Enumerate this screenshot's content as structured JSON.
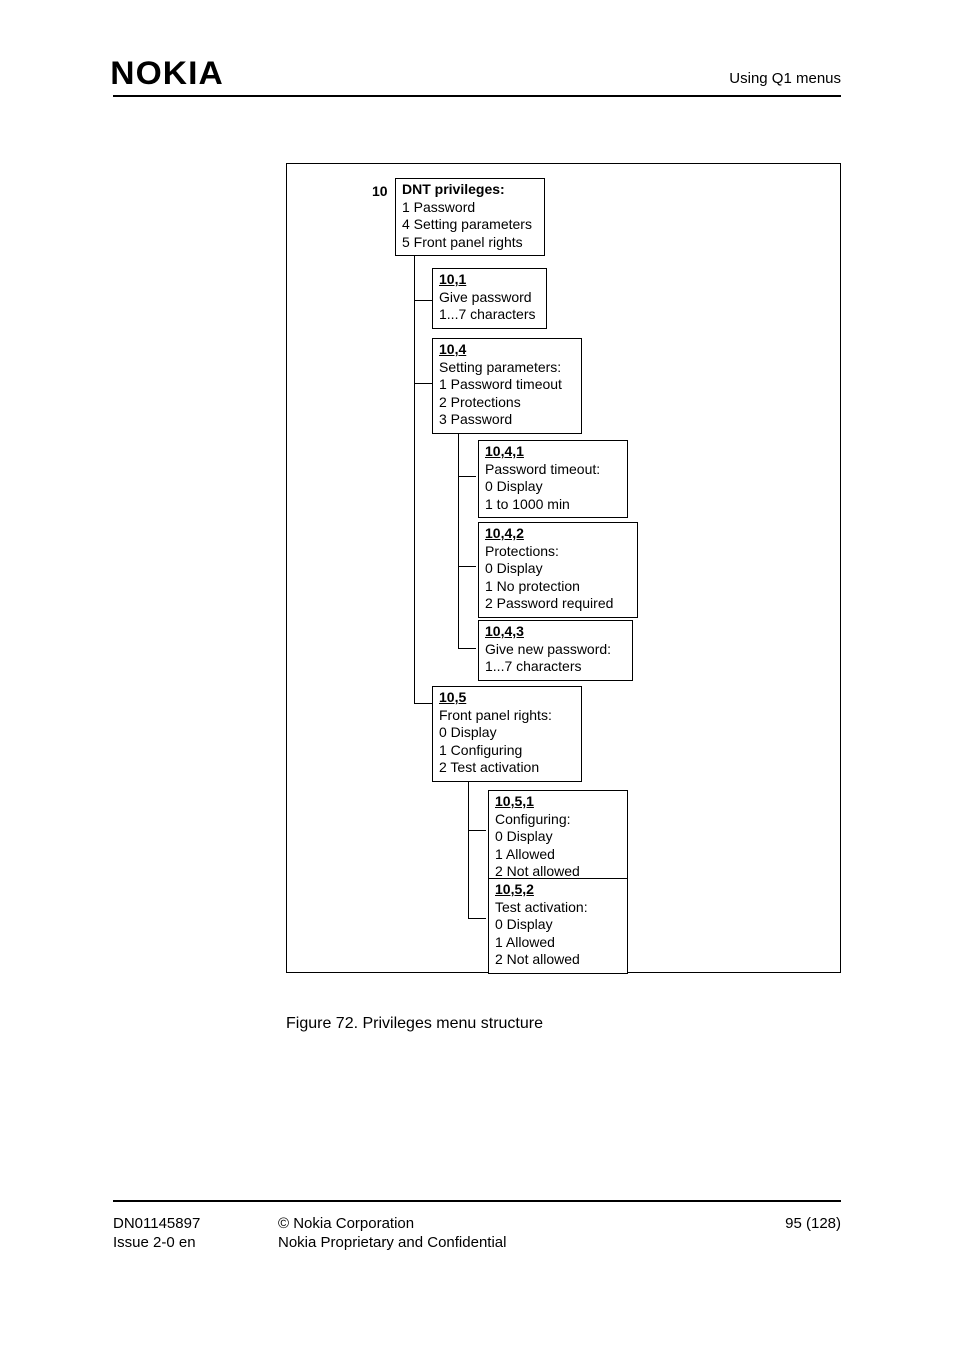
{
  "header": {
    "logo": "NOKIA",
    "right": "Using Q1 menus"
  },
  "caption": "Figure 72.    Privileges menu structure",
  "footer": {
    "doc_id": "DN01145897",
    "issue": "Issue 2-0 en",
    "copyright": "© Nokia Corporation",
    "confidential": "Nokia Proprietary and Confidential",
    "page": "95 (128)"
  },
  "tree": {
    "root_num": "10",
    "root": {
      "title": "DNT privileges:",
      "lines": [
        "1 Password",
        "4 Setting parameters",
        "5 Front panel rights"
      ]
    },
    "n10_1": {
      "title": "10,1",
      "lines": [
        "Give password",
        "1...7 characters"
      ]
    },
    "n10_4": {
      "title": "10,4",
      "lines": [
        "Setting parameters:",
        "1 Password timeout",
        "2 Protections",
        "3 Password"
      ]
    },
    "n10_4_1": {
      "title": "10,4,1",
      "lines": [
        "Password timeout:",
        "0 Display",
        "1 to 1000 min"
      ]
    },
    "n10_4_2": {
      "title": "10,4,2",
      "lines": [
        "Protections:",
        "0 Display",
        "1 No protection",
        "2 Password required"
      ]
    },
    "n10_4_3": {
      "title": "10,4,3",
      "lines": [
        "Give new password:",
        "1...7 characters"
      ]
    },
    "n10_5": {
      "title": "10,5",
      "lines": [
        "Front panel rights:",
        "0 Display",
        "1 Configuring",
        "2 Test activation"
      ]
    },
    "n10_5_1": {
      "title": "10,5,1",
      "lines": [
        "Configuring:",
        "0 Display",
        "1 Allowed",
        "2 Not allowed"
      ]
    },
    "n10_5_2": {
      "title": "10,5,2",
      "lines": [
        "Test activation:",
        "0 Display",
        "1 Allowed",
        "2 Not allowed"
      ]
    }
  }
}
